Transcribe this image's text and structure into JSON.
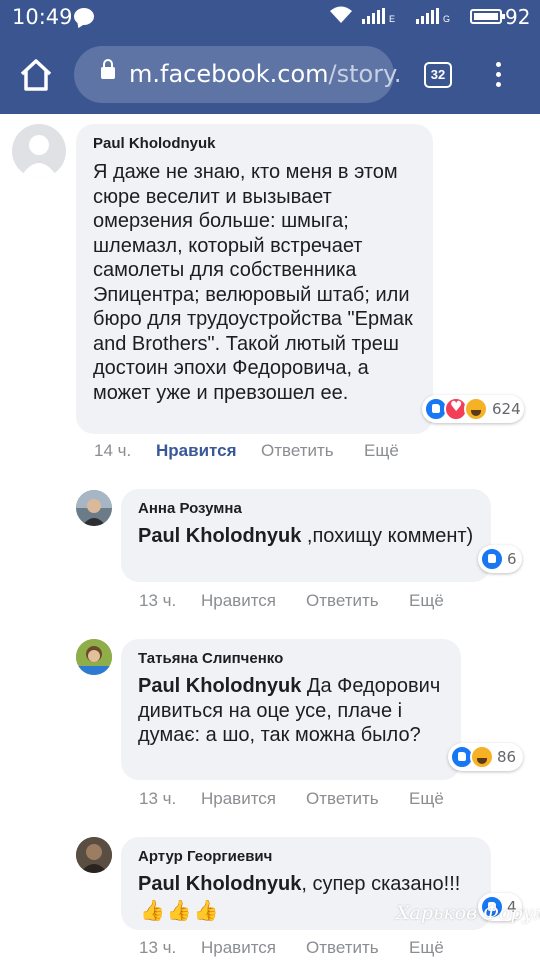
{
  "status_bar": {
    "time": "10:49",
    "network1_label": "E",
    "network2_label": "G",
    "battery": "92"
  },
  "browser": {
    "url_host": "m.facebook.com",
    "url_path": "/story.",
    "tab_count": "32"
  },
  "comments": [
    {
      "author": "Paul Kholodnyuk",
      "mention": "",
      "text": "Я даже не знаю, кто меня в этом сюре веселит и вызывает омерзения больше: шмыга; шлемазл, который встречает самолеты для собственника Эпицентра; велюровый штаб; или бюро для трудоустройства \"Ермак and Brothers\". Такой лютый треш достоин эпохи Федоровича, а может уже и превзошел ее.",
      "time": "14 ч.",
      "like": "Нравится",
      "reply": "Ответить",
      "more": "Ещё",
      "reaction_count": "624"
    },
    {
      "author": "Анна Розумна",
      "mention": "Paul Kholodnyuk",
      "text": " ,похищу коммент)",
      "time": "13 ч.",
      "like": "Нравится",
      "reply": "Ответить",
      "more": "Ещё",
      "reaction_count": "6"
    },
    {
      "author": "Татьяна Слипченко",
      "mention": "Paul Kholodnyuk",
      "text": " Да Федорович дивиться на оце усе, плаче і думає: а шо, так можна было?",
      "time": "13 ч.",
      "like": "Нравится",
      "reply": "Ответить",
      "more": "Ещё",
      "reaction_count": "86"
    },
    {
      "author": "Артур Георгиевич",
      "mention": "Paul Kholodnyuk",
      "text": ", супер сказано!!!",
      "emoji": "👍👍👍",
      "time": "13 ч.",
      "like": "Нравится",
      "reply": "Ответить",
      "more": "Ещё",
      "reaction_count": "4"
    }
  ],
  "watermark": "Харьков Форум",
  "colors": {
    "header": "#3b5591",
    "url_pill": "#5d74a5",
    "bubble": "#f0f2f5",
    "liked": "#385898",
    "like_reaction": "#1877f2",
    "love_reaction": "#f33e58",
    "haha_reaction": "#f7b125"
  }
}
